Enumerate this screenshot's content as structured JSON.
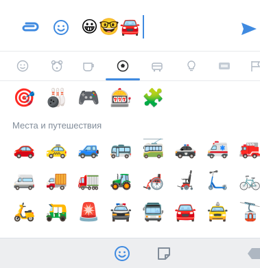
{
  "composer": {
    "message_text": "😀🤓🚘",
    "attach_icon": "paperclip-icon",
    "emoji_icon": "smile-icon",
    "send_icon": "send-arrow-icon",
    "accent_color": "#3f8ae0"
  },
  "categories": [
    {
      "name": "smileys",
      "icon": "smile-icon"
    },
    {
      "name": "animals",
      "icon": "bear-icon"
    },
    {
      "name": "food",
      "icon": "cup-icon"
    },
    {
      "name": "activities",
      "icon": "soccer-ball-icon",
      "active": true
    },
    {
      "name": "travel",
      "icon": "car-icon"
    },
    {
      "name": "objects",
      "icon": "lightbulb-icon"
    },
    {
      "name": "symbols",
      "icon": "symbols-icon"
    },
    {
      "name": "flags",
      "icon": "flag-icon"
    }
  ],
  "activities_row": [
    "🎯",
    "🎳",
    "🎮",
    "🎰",
    "🧩"
  ],
  "travel_section_title": "Места и путешествия",
  "travel_rows": [
    [
      "🚗",
      "🚕",
      "🚙",
      "🚌",
      "🚎",
      "🚓",
      "🚑",
      "🚒"
    ],
    [
      "🚐",
      "🚚",
      "🚛",
      "🚜",
      "🦽",
      "🦼",
      "🛴",
      "🚲"
    ],
    [
      "🛵",
      "🛺",
      "🚨",
      "🚔",
      "🚍",
      "🚘",
      "🚖",
      "🚡"
    ]
  ],
  "bottom_tabs": {
    "emoji_tab_icon": "smile-icon",
    "sticker_tab_icon": "sticker-icon",
    "backspace_icon": "backspace-icon"
  }
}
